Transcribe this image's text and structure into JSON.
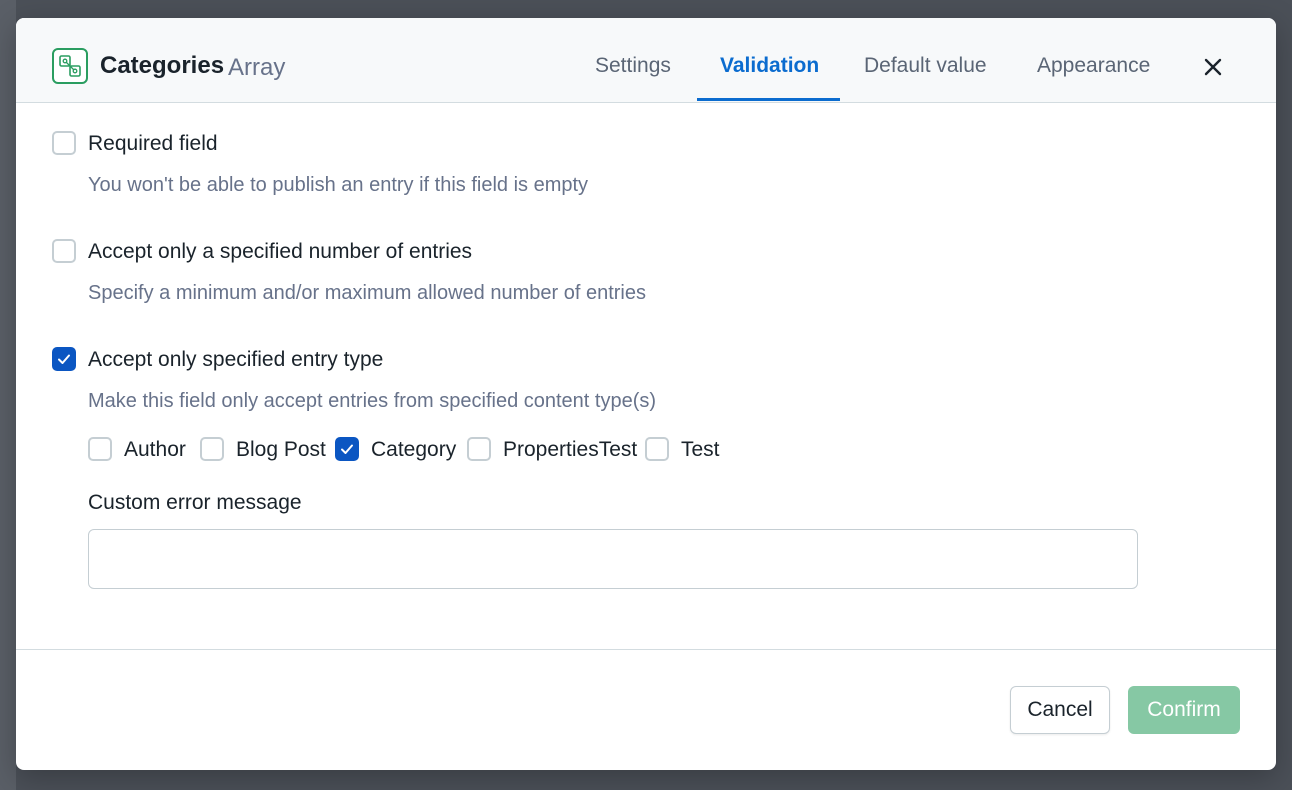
{
  "header": {
    "field_name": "Categories",
    "field_type": "Array",
    "field_icon": "reference-entries-icon",
    "tabs": [
      {
        "label": "Settings",
        "active": false
      },
      {
        "label": "Validation",
        "active": true
      },
      {
        "label": "Default value",
        "active": false
      },
      {
        "label": "Appearance",
        "active": false
      }
    ],
    "close_icon": "close-icon"
  },
  "validations": [
    {
      "label": "Required field",
      "help": "You won't be able to publish an entry if this field is empty",
      "checked": false
    },
    {
      "label": "Accept only a specified number of entries",
      "help": "Specify a minimum and/or maximum allowed number of entries",
      "checked": false
    },
    {
      "label": "Accept only specified entry type",
      "help": "Make this field only accept entries from specified content type(s)",
      "checked": true
    }
  ],
  "content_types": [
    {
      "label": "Author",
      "checked": false
    },
    {
      "label": "Blog Post",
      "checked": false
    },
    {
      "label": "Category",
      "checked": true
    },
    {
      "label": "PropertiesTest",
      "checked": false
    },
    {
      "label": "Test",
      "checked": false
    }
  ],
  "custom_error": {
    "label": "Custom error message",
    "value": "",
    "placeholder": ""
  },
  "footer": {
    "cancel_label": "Cancel",
    "confirm_label": "Confirm"
  },
  "colors": {
    "accent": "#0b6ccf",
    "checkbox_checked": "#0b56c2",
    "confirm_disabled": "#86c8a4",
    "icon_green": "#2a9d60"
  }
}
